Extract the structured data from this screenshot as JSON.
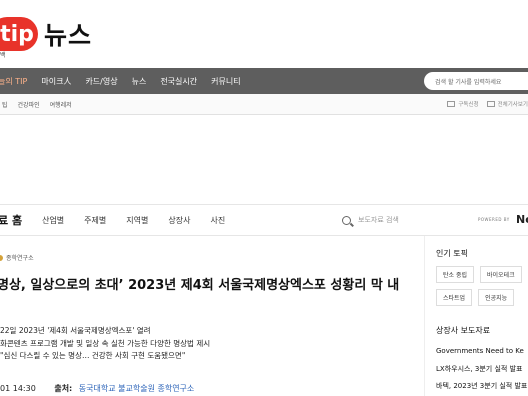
{
  "header": {
    "logo_tip": "tip",
    "logo_news": "뉴스",
    "logo_sub": "백"
  },
  "nav": {
    "items": [
      "늘의 TIP",
      "마이크人",
      "카드/영상",
      "뉴스",
      "전국실시간",
      "커뮤니티"
    ],
    "search_placeholder": "검색 할 기사를 입력하세요"
  },
  "subnav": {
    "items": [
      "팁",
      "건강파인",
      "여행레저"
    ],
    "right": [
      "구독신청",
      "전체기사보기"
    ]
  },
  "pressbar": {
    "home": "료 홈",
    "items": [
      "산업별",
      "주제별",
      "지역별",
      "상장사",
      "사진"
    ],
    "search_placeholder": "보도자료 검색",
    "powered": "POWERED BY",
    "brand": "Ne"
  },
  "article": {
    "org": "종학연구소",
    "title": "명상, 일상으로의 초대’ 2023년 제4회 서울국제명상엑스포 성황리 막 내",
    "bullets": [
      "22일 2023년 '제4회 서울국제명상엑스포' 열려",
      "화콘텐츠 프로그램 개발 및 일상 속 실천 가능한 다양한 명상법 제시",
      "\"심신 다스릴 수 있는 명상… 건강한 사회 구현 도움됐으면\""
    ],
    "date": "01 14:30",
    "source_label": "출처:",
    "source": "동국대학교 불교학술원 종학연구소"
  },
  "sidebar": {
    "topics_heading": "인기 토픽",
    "topics": [
      "탄소 중립",
      "바이오테크",
      "스타트업",
      "인공지능"
    ],
    "related_heading": "상장사 보도자료",
    "related": [
      "Governments Need to Ke",
      "LX하우시스, 3분기 실적 발표",
      "바텍, 2023년 3분기 실적 발표"
    ]
  },
  "colors": {
    "brand_red": "#e8332a",
    "nav_bg": "#5e5e5e",
    "link_blue": "#2b63b8"
  }
}
